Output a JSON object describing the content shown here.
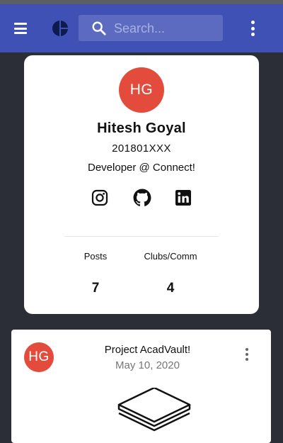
{
  "appbar": {
    "search_placeholder": "Search...",
    "colors": {
      "primary": "#3f51b5",
      "search_bg": "#5c6bc0"
    },
    "icons": [
      "menu-icon",
      "logo-icon",
      "search-icon",
      "more-vert-icon"
    ]
  },
  "profile": {
    "initials": "HG",
    "name": "Hitesh Goyal",
    "roll_no": "201801XXX",
    "bio": "Developer @ Connect!",
    "avatar_color": "#e34b3c",
    "social_icons": [
      "instagram-icon",
      "github-icon",
      "linkedin-icon"
    ],
    "stats": [
      {
        "label": "Posts",
        "value": "7"
      },
      {
        "label": "Clubs/Comm",
        "value": "4"
      }
    ]
  },
  "post": {
    "initials": "HG",
    "title": "Project AcadVault!",
    "date": "May 10, 2020",
    "image_icon": "stacked-layers-icon"
  }
}
